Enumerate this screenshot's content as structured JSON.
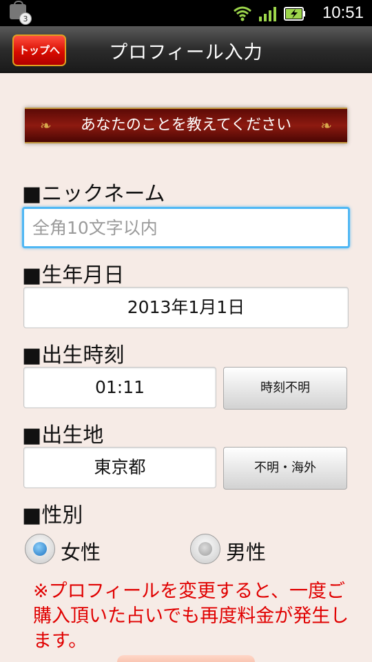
{
  "status_bar": {
    "notification_count": "3",
    "time": "10:51",
    "icons": [
      "shopping-bag-icon",
      "wifi-icon",
      "signal-icon",
      "battery-charging-icon"
    ]
  },
  "header": {
    "back_button_label": "トップへ",
    "title": "プロフィール入力"
  },
  "banner": {
    "text": "あなたのことを教えてください"
  },
  "form": {
    "nickname": {
      "label": "■ニックネーム",
      "value": "",
      "placeholder": "全角10文字以内"
    },
    "birthdate": {
      "label": "■生年月日",
      "value": "2013年1月1日"
    },
    "birth_time": {
      "label": "■出生時刻",
      "value": "01:11",
      "unknown_button": "時刻不明"
    },
    "birthplace": {
      "label": "■出生地",
      "value": "東京都",
      "unknown_button": "不明・海外"
    },
    "gender": {
      "label": "■性別",
      "options": [
        {
          "label": "女性",
          "selected": true
        },
        {
          "label": "男性",
          "selected": false
        }
      ]
    }
  },
  "notice": "※プロフィールを変更すると、一度ご購入頂いた占いでも再度料金が発生します。",
  "colors": {
    "background": "#f6ebe6",
    "accent_red": "#e00000",
    "focus_blue": "#4fb7f4",
    "banner_red": "#8d1a10"
  }
}
